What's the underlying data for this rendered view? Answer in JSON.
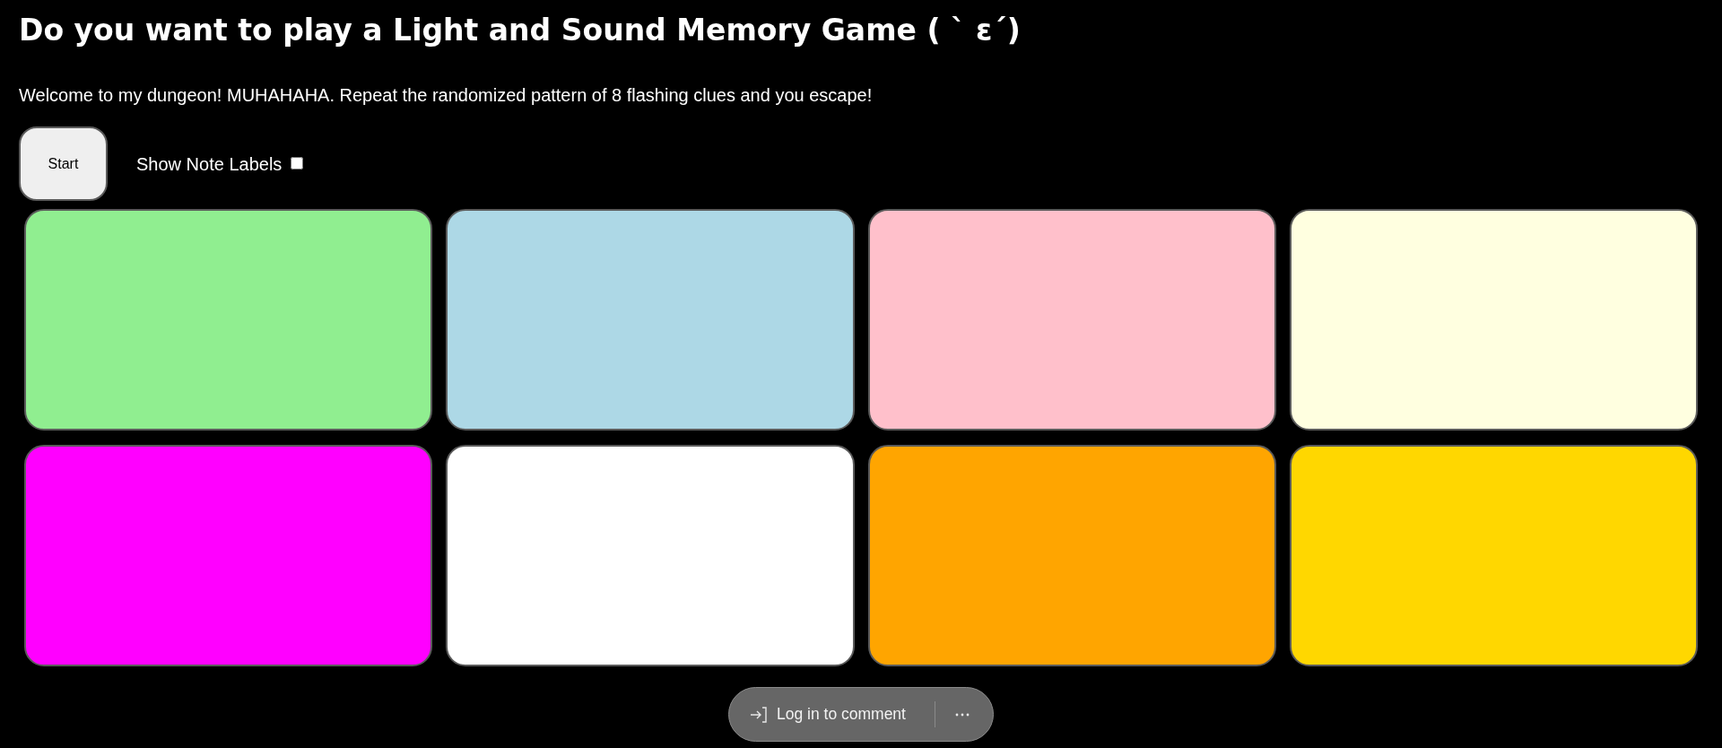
{
  "title": "Do you want to play a Light and Sound Memory Game ( ` ε´)",
  "intro": "Welcome to my dungeon! MUHAHAHA. Repeat the randomized pattern of 8 flashing clues and you escape!",
  "start_button": {
    "label": "Start"
  },
  "note_labels_toggle": {
    "label": "Show Note Labels",
    "checked": false
  },
  "game_buttons": [
    {
      "color": "#90ee90"
    },
    {
      "color": "#add8e6"
    },
    {
      "color": "#ffc0cb"
    },
    {
      "color": "#ffffe0"
    },
    {
      "color": "#ff00ff"
    },
    {
      "color": "#ffffff"
    },
    {
      "color": "#ffa500"
    },
    {
      "color": "#ffd700"
    }
  ],
  "comment_bar": {
    "label": "Log in to comment"
  }
}
